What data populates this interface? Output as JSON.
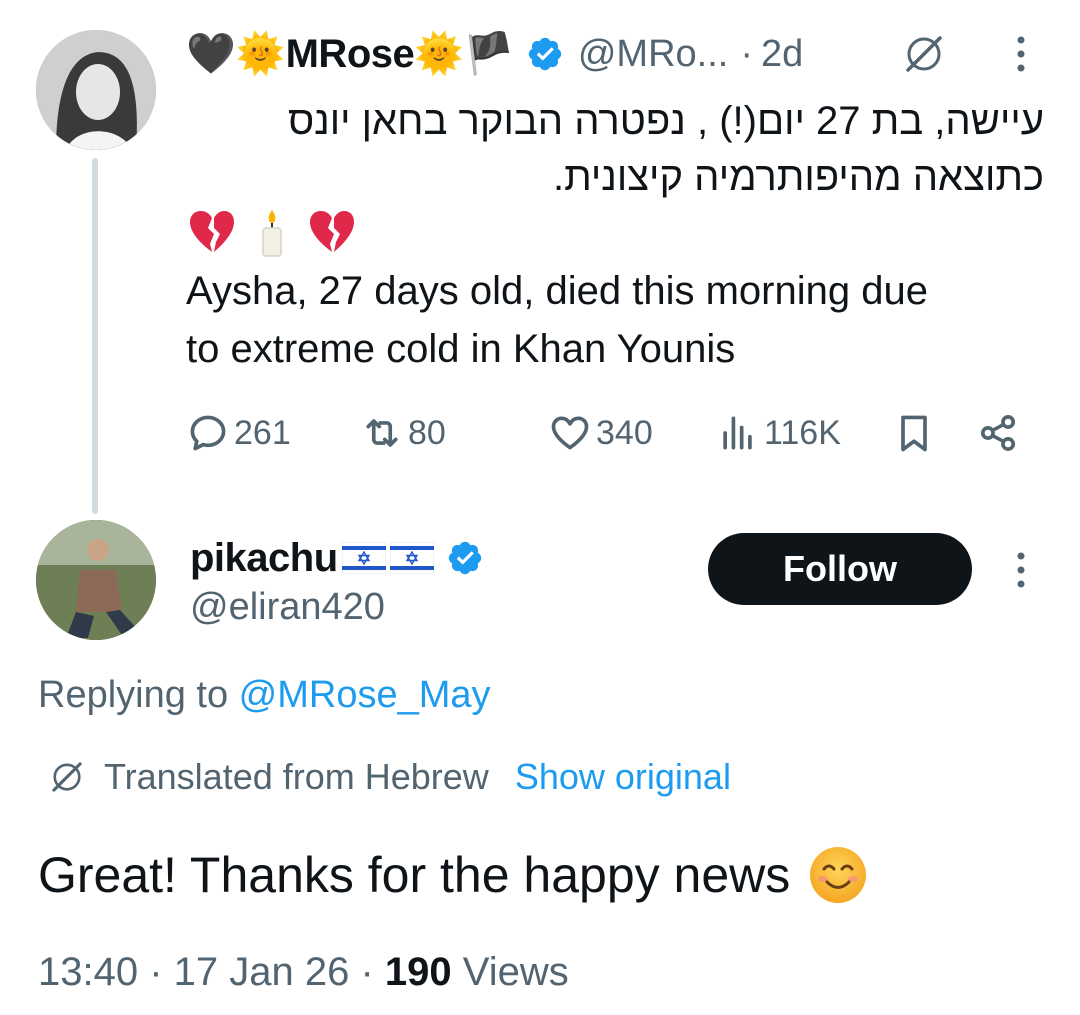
{
  "parent_tweet": {
    "author": {
      "name_prefix_emoji": "🖤🌞",
      "display_name": "MRose",
      "name_suffix_emoji": "🌞🏴",
      "handle": "@MRo...",
      "verified": true
    },
    "time_separator": "·",
    "time": "2d",
    "text_hebrew_line1": "עיישה, בת 27 יום(!) , נפטרה הבוקר בחאן יונס",
    "text_hebrew_line2": "כתוצאה מהיפותרמיה קיצונית.",
    "emoji_line": "💔🕯️💔",
    "text_english_line1": "Aysha, 27 days old, died this morning due",
    "text_english_line2": "to extreme cold in Khan Younis",
    "stats": {
      "replies": "261",
      "reposts": "80",
      "likes": "340",
      "views": "116K"
    }
  },
  "reply_tweet": {
    "author": {
      "display_name": "pikachu",
      "name_flags": "🇮🇱🇮🇱",
      "handle": "@eliran420",
      "verified": true
    },
    "follow_label": "Follow",
    "replying_prefix": "Replying to ",
    "replying_mention": "@MRose_May",
    "translated_label": "Translated from Hebrew",
    "show_original_label": "Show original",
    "text": "Great! Thanks for the happy news",
    "text_emoji": "😊",
    "meta": {
      "time": "13:40",
      "sep1": " · ",
      "date": "17 Jan 26",
      "sep2": " · ",
      "views_count": "190",
      "views_label": " Views"
    }
  },
  "colors": {
    "text_primary": "#0f1419",
    "text_secondary": "#536471",
    "accent": "#1d9bf0",
    "thread_line": "#cfd9de",
    "follow_bg": "#0f1419"
  },
  "icons": [
    "grok-translate-icon",
    "more-icon",
    "reply-icon",
    "repost-icon",
    "like-icon",
    "views-icon",
    "bookmark-icon",
    "share-icon",
    "verified-badge-icon",
    "israel-flag-icon",
    "broken-heart-icon",
    "candle-icon",
    "smiling-face-icon"
  ]
}
